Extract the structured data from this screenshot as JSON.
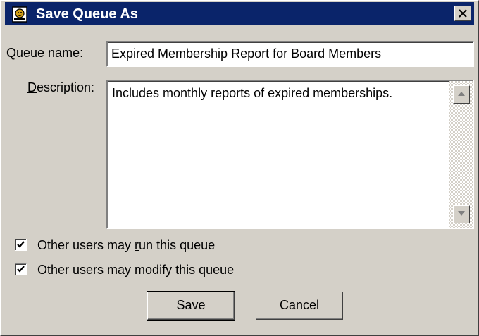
{
  "window": {
    "title": "Save Queue As",
    "title_color": "#0a246a",
    "icon": "queue-app-icon",
    "close_icon": "close-icon"
  },
  "form": {
    "queue_name": {
      "label": "Queue name:",
      "value": "Expired Membership Report for Board Members"
    },
    "description": {
      "label": "Description:",
      "value": "Includes monthly reports of expired memberships."
    }
  },
  "options": [
    {
      "label": "Other users may run this queue",
      "checked": true
    },
    {
      "label": "Other users may modify this queue",
      "checked": true
    }
  ],
  "buttons": {
    "save": "Save",
    "cancel": "Cancel"
  }
}
